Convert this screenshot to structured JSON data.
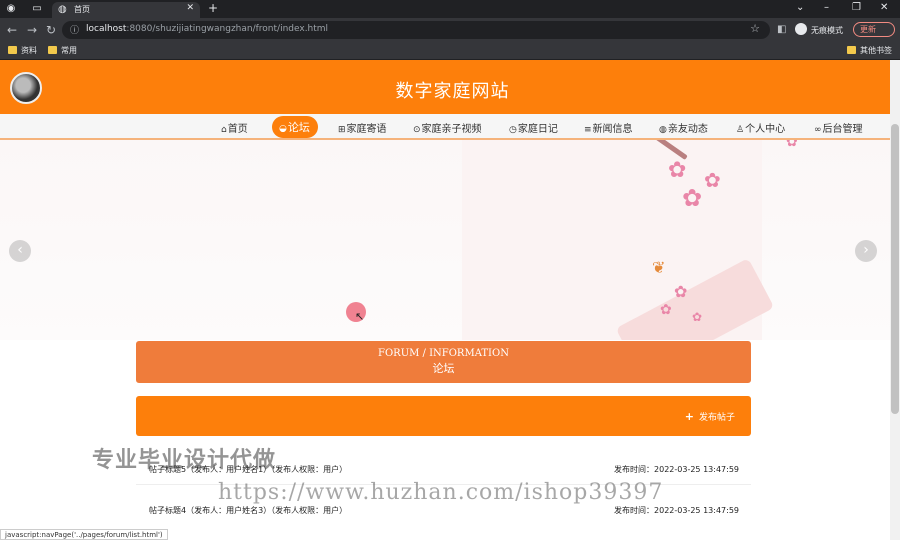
{
  "browser": {
    "tab_title": "首页",
    "url_host": "localhost",
    "url_path": ":8080/shuzijiatingwangzhan/front/index.html",
    "profile_label": "无痕模式",
    "update_label": "更新",
    "bookmarks": [
      "资料",
      "常用"
    ],
    "other_bookmarks": "其他书签",
    "status_url": "javascript:navPage('../pages/forum/list.html')"
  },
  "site": {
    "title": "数字家庭网站"
  },
  "nav": {
    "items": [
      {
        "label": "首页",
        "icon": "home-icon"
      },
      {
        "label": "论坛",
        "icon": "forum-icon"
      },
      {
        "label": "家庭寄语",
        "icon": "book-icon"
      },
      {
        "label": "家庭亲子视频",
        "icon": "video-icon"
      },
      {
        "label": "家庭日记",
        "icon": "clock-icon"
      },
      {
        "label": "新闻信息",
        "icon": "news-icon"
      },
      {
        "label": "亲友动态",
        "icon": "globe-icon"
      },
      {
        "label": "个人中心",
        "icon": "user-icon"
      },
      {
        "label": "后台管理",
        "icon": "link-icon"
      }
    ],
    "active_index": 1
  },
  "carousel": {
    "slide_count": 3,
    "active_slide": 1
  },
  "section": {
    "title_en": "FORUM / INFORMATION",
    "title_zh": "论坛",
    "post_button": "发布帖子"
  },
  "posts": [
    {
      "title": "帖子标题5（发布人：用户姓名1）（发布人权限：用户）",
      "time": "发布时间：2022-03-25 13:47:59"
    },
    {
      "title": "帖子标题4（发布人：用户姓名3）（发布人权限：用户）",
      "time": "发布时间：2022-03-25 13:47:59"
    }
  ],
  "watermark": {
    "line1": "专业毕业设计代做",
    "line2": "https://www.huzhan.com/ishop39397"
  },
  "colors": {
    "brand_orange": "#fd7f0b",
    "banner_orange": "#ef7c3b"
  }
}
